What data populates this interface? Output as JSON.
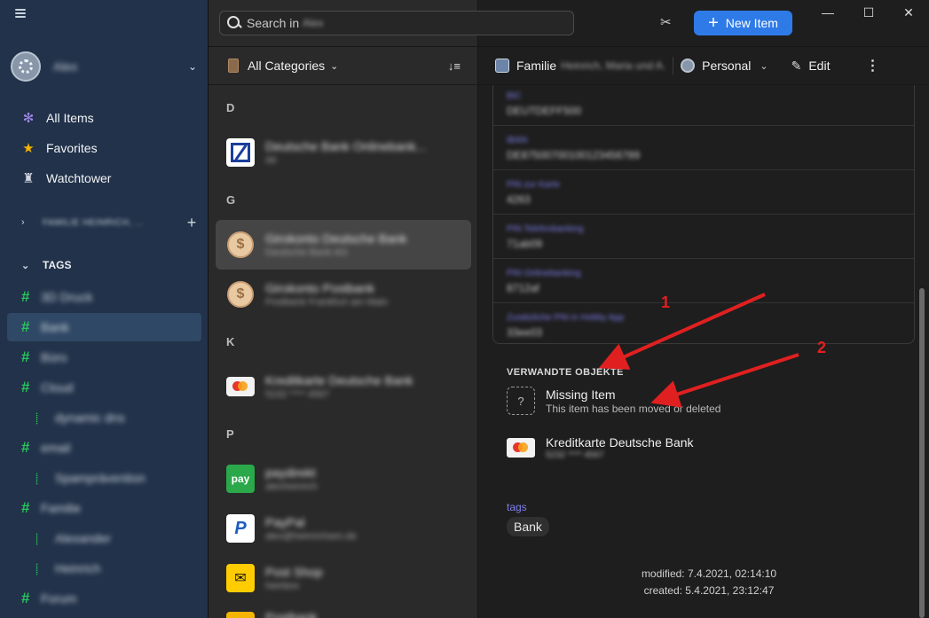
{
  "search": {
    "placeholder": "Search in",
    "vault_blurred": "Alex"
  },
  "toolbar": {
    "new_item_label": "New Item",
    "tools_icon": "tools-icon"
  },
  "window_controls": {
    "minimize": "—",
    "maximize": "☐",
    "close": "✕"
  },
  "sidebar": {
    "account_name": "Alex",
    "nav": [
      {
        "label": "All Items",
        "icon": "grid-icon"
      },
      {
        "label": "Favorites",
        "icon": "star-icon"
      },
      {
        "label": "Watchtower",
        "icon": "tower-icon"
      }
    ],
    "vault_name": "FAMILIE HEINRICH, ...",
    "tags_heading": "TAGS",
    "tags": [
      {
        "label": "3D Druck",
        "level": 0
      },
      {
        "label": "Bank",
        "level": 0,
        "selected": true
      },
      {
        "label": "Büro",
        "level": 0
      },
      {
        "label": "Cloud",
        "level": 0
      },
      {
        "label": "dynamic dns",
        "level": 1
      },
      {
        "label": "email",
        "level": 0
      },
      {
        "label": "Spamprävention",
        "level": 1
      },
      {
        "label": "Familie",
        "level": 0
      },
      {
        "label": "Alexander",
        "level": 1
      },
      {
        "label": "Heinrich",
        "level": 1
      },
      {
        "label": "Forum",
        "level": 0
      }
    ]
  },
  "list": {
    "category_label": "All Categories",
    "sections": [
      {
        "letter": "D"
      },
      {
        "letter": "G"
      },
      {
        "letter": "K"
      },
      {
        "letter": "P"
      }
    ],
    "items": [
      {
        "title": "Deutsche Bank Onlinebank...",
        "subtitle": "Ali",
        "icon": "deutsche-bank-icon"
      },
      {
        "title": "Girokonto Deutsche Bank",
        "subtitle": "Deutsche Bank AG",
        "icon": "coin-icon",
        "selected": true
      },
      {
        "title": "Girokonto Postbank",
        "subtitle": "Postbank Frankfurt am Main",
        "icon": "coin-icon"
      },
      {
        "title": "Kreditkarte Deutsche Bank",
        "subtitle": "5232 **** 4567",
        "icon": "mastercard-icon"
      },
      {
        "title": "paydirekt",
        "subtitle": "alexheinrich",
        "icon": "paydirekt-icon",
        "icon_text": "pay"
      },
      {
        "title": "PayPal",
        "subtitle": "alex@heinrichsen.de",
        "icon": "paypal-icon",
        "icon_text": "P"
      },
      {
        "title": "Post Shop",
        "subtitle": "heinbox",
        "icon": "post-shop-icon",
        "icon_text": "✉"
      },
      {
        "title": "Postbank",
        "subtitle": "",
        "icon": "postbank-icon"
      }
    ]
  },
  "detail": {
    "vault_label": "Familie",
    "vault_members_blurred": "Heinrich, Maria und A...",
    "personal_label": "Personal",
    "edit_label": "Edit",
    "fields": [
      {
        "label": "BIC",
        "value": "DEUTDEFF500"
      },
      {
        "label": "IBAN",
        "value": "DE87500700100123456789"
      },
      {
        "label": "PIN zur Karte",
        "value": "4263"
      },
      {
        "label": "PIN Telefonbanking",
        "value": "71ab09"
      },
      {
        "label": "PIN Onlinebanking",
        "value": "8712af"
      },
      {
        "label": "Zusätzliche PIN in Hobby App",
        "value": "33ee03"
      }
    ],
    "related_heading": "VERWANDTE OBJEKTE",
    "related": [
      {
        "title": "Missing Item",
        "subtitle": "This item has been moved or deleted",
        "icon": "question-icon"
      },
      {
        "title": "Kreditkarte Deutsche Bank",
        "subtitle": "5232 **** 4567",
        "icon": "mastercard-icon"
      }
    ],
    "tags_label": "tags",
    "tags": [
      "Bank"
    ],
    "modified": "modified: 7.4.2021, 02:14:10",
    "created": "created: 5.4.2021, 23:12:47"
  },
  "annotations": {
    "marker_1": "1",
    "marker_2": "2",
    "arrow_color": "#e02020"
  }
}
